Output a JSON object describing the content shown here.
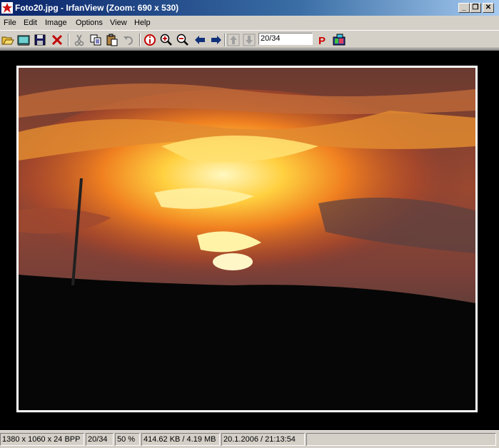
{
  "window": {
    "title": "Foto20.jpg - IrfanView (Zoom: 690 x 530)",
    "controls": {
      "minimize": "_",
      "restore": "❐",
      "close": "✕"
    }
  },
  "menu": {
    "items": [
      "File",
      "Edit",
      "Image",
      "Options",
      "View",
      "Help"
    ]
  },
  "toolbar": {
    "buttons": [
      "open-folder-icon",
      "slideshow-icon",
      "save-icon",
      "delete-icon",
      "cut-icon",
      "copy-icon",
      "paste-icon",
      "undo-icon",
      "info-icon",
      "zoom-in-icon",
      "zoom-out-icon",
      "previous-icon",
      "next-icon",
      "first-file-icon",
      "last-file-icon",
      "print-icon",
      "paint-icon"
    ],
    "page_value": "20/34"
  },
  "status": {
    "dimensions": "1380 x 1060 x 24 BPP",
    "index": "20/34",
    "zoom": "50 %",
    "filesize": "414.62 KB / 4.19 MB",
    "datetime": "20.1.2006 / 21:13:54"
  },
  "colors": {
    "titlebar_start": "#0a246a",
    "titlebar_end": "#a6caf0",
    "chrome": "#d4d0c8",
    "viewer_bg": "#000000",
    "photo_border": "#ffffff"
  }
}
